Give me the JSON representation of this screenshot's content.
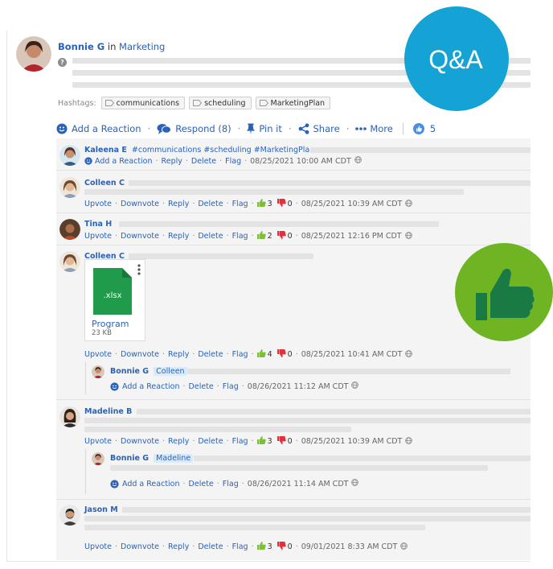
{
  "post": {
    "author": "Bonnie G",
    "in_word": "in",
    "group": "Marketing",
    "hashtags_label": "Hashtags:",
    "hashtags": [
      "communications",
      "scheduling",
      "MarketingPlan"
    ],
    "toolbar": {
      "add_reaction": "Add a Reaction",
      "respond": "Respond (8)",
      "pin": "Pin it",
      "share": "Share",
      "more": "More",
      "reaction_count": "5"
    }
  },
  "badges": {
    "qa": "Q&A"
  },
  "replies": [
    {
      "author": "Kaleena E",
      "text": "#communications #scheduling #MarketingPlan",
      "actions": [
        "Add a Reaction",
        "Reply",
        "Delete",
        "Flag"
      ],
      "timestamp": "08/25/2021 10:00 AM CDT"
    },
    {
      "author": "Colleen C",
      "actions": [
        "Upvote",
        "Downvote",
        "Reply",
        "Delete",
        "Flag"
      ],
      "up": "3",
      "down": "0",
      "timestamp": "08/25/2021 10:39 AM CDT"
    },
    {
      "author": "Tina H",
      "actions": [
        "Upvote",
        "Downvote",
        "Reply",
        "Delete",
        "Flag"
      ],
      "up": "2",
      "down": "0",
      "timestamp": "08/25/2021 12:16 PM CDT"
    },
    {
      "author": "Colleen C",
      "file": {
        "ext": ".xlsx",
        "name": "Program",
        "size": "23 KB"
      },
      "actions": [
        "Upvote",
        "Downvote",
        "Reply",
        "Delete",
        "Flag"
      ],
      "up": "4",
      "down": "0",
      "timestamp": "08/25/2021 10:41 AM CDT",
      "nested": {
        "author": "Bonnie G",
        "mention": "Colleen",
        "actions": [
          "Add a Reaction",
          "Delete",
          "Flag"
        ],
        "timestamp": "08/26/2021 11:12 AM CDT"
      }
    },
    {
      "author": "Madeline B",
      "actions": [
        "Upvote",
        "Downvote",
        "Reply",
        "Delete",
        "Flag"
      ],
      "up": "3",
      "down": "0",
      "timestamp": "08/25/2021 10:39 AM CDT",
      "nested": {
        "author": "Bonnie G",
        "mention": "Madeline",
        "actions": [
          "Add a Reaction",
          "Delete",
          "Flag"
        ],
        "timestamp": "08/26/2021 11:14 AM CDT"
      }
    },
    {
      "author": "Jason M",
      "actions": [
        "Upvote",
        "Downvote",
        "Reply",
        "Delete",
        "Flag"
      ],
      "up": "3",
      "down": "0",
      "timestamp": "09/01/2021 8:33 AM CDT"
    }
  ],
  "colors": {
    "link": "#2a62b7",
    "qa_badge": "#14a3d4",
    "thumb_badge": "#6fb523",
    "upvote": "#7cc034",
    "downvote": "#e0323c"
  }
}
